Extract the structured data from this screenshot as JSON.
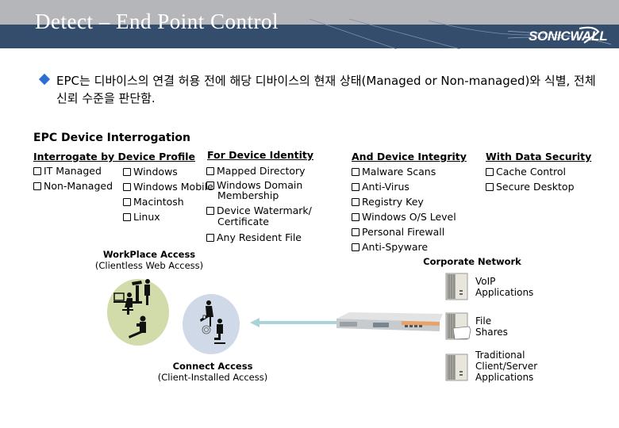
{
  "header": {
    "title": "Detect – End Point Control",
    "logo": "SONICWALL",
    "colors": {
      "band_top": "#b4b6b9",
      "band_bottom": "#344d6c",
      "bullet": "#2a6fd1"
    }
  },
  "intro": {
    "text": "EPC는 디바이스의 연결 허용 전에 해당 디바이스의 현재 상태(Managed or Non-managed)와 식별, 전체 신뢰 수준을 판단함."
  },
  "diagram": {
    "title": "EPC Device Interrogation",
    "columns": [
      {
        "heading": "Interrogate by Device Profile",
        "items_left": [
          "IT Managed",
          "Non-Managed"
        ],
        "items_right": [
          "Windows",
          "Windows Mobile",
          "Macintosh",
          "Linux"
        ]
      },
      {
        "heading": "For Device Identity",
        "items": [
          "Mapped Directory",
          "Windows Domain Membership",
          "Device Watermark/ Certificate",
          "Any Resident File"
        ]
      },
      {
        "heading": "And Device Integrity",
        "items": [
          "Malware Scans",
          "Anti-Virus",
          "Registry Key",
          "Windows O/S Level",
          "Personal Firewall",
          "Anti-Spyware"
        ]
      },
      {
        "heading": "With Data Security",
        "items": [
          "Cache Control",
          "Secure Desktop"
        ]
      }
    ],
    "workplace": {
      "title": "WorkPlace Access",
      "subtitle": "(Clientless Web Access)"
    },
    "connect": {
      "title": "Connect Access",
      "subtitle": "(Client-Installed Access)"
    },
    "corporate_network": "Corporate Network",
    "servers": [
      {
        "line1": "VoIP",
        "line2": "Applications",
        "line3": ""
      },
      {
        "line1": "File",
        "line2": "Shares",
        "line3": ""
      },
      {
        "line1": "Traditional",
        "line2": "Client/Server",
        "line3": "Applications"
      }
    ]
  }
}
